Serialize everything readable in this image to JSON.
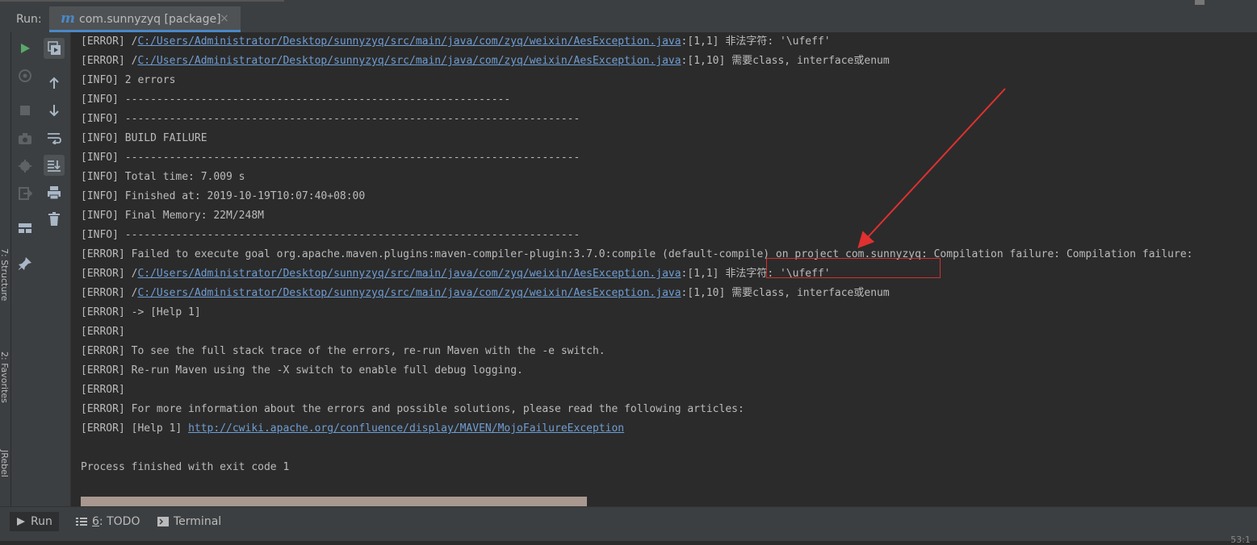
{
  "run_panel": {
    "label": "Run:",
    "tab": {
      "icon_letter": "m",
      "title": "com.sunnyzyq [package]",
      "close": "×"
    }
  },
  "side_tabs": {
    "structure": "7: Structure",
    "favorites": "2: Favorites",
    "jrebel": "JRebel"
  },
  "console": {
    "lines": [
      {
        "prefix": "[ERROR] /",
        "link": "C:/Users/Administrator/Desktop/sunnyzyq/src/main/java/com/zyq/weixin/AesException.java",
        "suffix": ":[1,1] 非法字符: '\\ufeff'"
      },
      {
        "prefix": "[ERROR] /",
        "link": "C:/Users/Administrator/Desktop/sunnyzyq/src/main/java/com/zyq/weixin/AesException.java",
        "suffix": ":[1,10] 需要class, interface或enum"
      },
      {
        "prefix": "[INFO] 2 errors",
        "link": "",
        "suffix": ""
      },
      {
        "prefix": "[INFO] -------------------------------------------------------------",
        "link": "",
        "suffix": ""
      },
      {
        "prefix": "[INFO] ------------------------------------------------------------------------",
        "link": "",
        "suffix": ""
      },
      {
        "prefix": "[INFO] BUILD FAILURE",
        "link": "",
        "suffix": ""
      },
      {
        "prefix": "[INFO] ------------------------------------------------------------------------",
        "link": "",
        "suffix": ""
      },
      {
        "prefix": "[INFO] Total time: 7.009 s",
        "link": "",
        "suffix": ""
      },
      {
        "prefix": "[INFO] Finished at: 2019-10-19T10:07:40+08:00",
        "link": "",
        "suffix": ""
      },
      {
        "prefix": "[INFO] Final Memory: 22M/248M",
        "link": "",
        "suffix": ""
      },
      {
        "prefix": "[INFO] ------------------------------------------------------------------------",
        "link": "",
        "suffix": ""
      },
      {
        "prefix": "[ERROR] Failed to execute goal org.apache.maven.plugins:maven-compiler-plugin:3.7.0:compile (default-compile) on project com.sunnyzyq: Compilation failure: Compilation failure:",
        "link": "",
        "suffix": ""
      },
      {
        "prefix": "[ERROR] /",
        "link": "C:/Users/Administrator/Desktop/sunnyzyq/src/main/java/com/zyq/weixin/AesException.java",
        "suffix": ":[1,1] 非法字符: '\\ufeff'"
      },
      {
        "prefix": "[ERROR] /",
        "link": "C:/Users/Administrator/Desktop/sunnyzyq/src/main/java/com/zyq/weixin/AesException.java",
        "suffix": ":[1,10] 需要class, interface或enum"
      },
      {
        "prefix": "[ERROR] -> [Help 1]",
        "link": "",
        "suffix": ""
      },
      {
        "prefix": "[ERROR]",
        "link": "",
        "suffix": ""
      },
      {
        "prefix": "[ERROR] To see the full stack trace of the errors, re-run Maven with the -e switch.",
        "link": "",
        "suffix": ""
      },
      {
        "prefix": "[ERROR] Re-run Maven using the -X switch to enable full debug logging.",
        "link": "",
        "suffix": ""
      },
      {
        "prefix": "[ERROR]",
        "link": "",
        "suffix": ""
      },
      {
        "prefix": "[ERROR] For more information about the errors and possible solutions, please read the following articles:",
        "link": "",
        "suffix": ""
      },
      {
        "prefix": "[ERROR] [Help 1] ",
        "link": "http://cwiki.apache.org/confluence/display/MAVEN/MojoFailureException",
        "suffix": ""
      },
      {
        "prefix": "",
        "link": "",
        "suffix": ""
      },
      {
        "prefix": "Process finished with exit code 1",
        "link": "",
        "suffix": ""
      }
    ],
    "highlighted_line_index": 12
  },
  "bottom_bar": {
    "run": "Run",
    "todo_num": "6",
    "todo_label": ": TODO",
    "terminal": "Terminal",
    "caret_pos": "53:1"
  },
  "colors": {
    "background": "#2b2b2b",
    "panel": "#3c3f41",
    "text": "#bbbbbb",
    "link": "#6f9dd3",
    "annotation_red": "#e03030",
    "run_green": "#59a869"
  }
}
